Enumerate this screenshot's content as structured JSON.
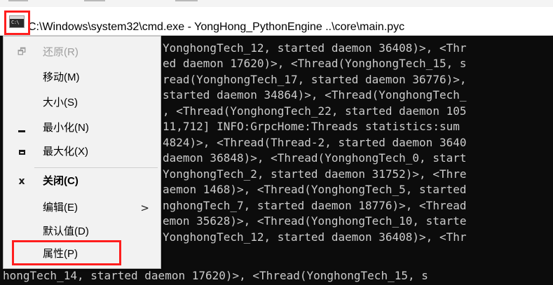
{
  "window": {
    "title": "C:\\Windows\\system32\\cmd.exe - YongHong_PythonEngine  ..\\core\\main.pyc",
    "icon_name": "cmd-icon",
    "icon_glyph": "C:\\"
  },
  "console": {
    "lines": [
      "YonghongTech_12, started daemon 36408)>, <Thr",
      "ed daemon 17620)>, <Thread(YonghongTech_15, s",
      "read(YonghongTech_17, started daemon 36776)>,",
      "started daemon 34864)>, <Thread(YonghongTech_",
      ", <Thread(YonghongTech_22, started daemon 105",
      "11,712] INFO:GrpcHome:Threads statistics:sum",
      "4824)>, <Thread(Thread-2, started daemon 3640",
      "daemon 36848)>, <Thread(YonghongTech_0, start",
      "YonghongTech_2, started daemon 31752)>, <Thre",
      "aemon 1468)>, <Thread(YonghongTech_5, started",
      "nghongTech_7, started daemon 18776)>, <Thread",
      "emon 35628)>, <Thread(YonghongTech_10, starte",
      "YonghongTech_12, started daemon 36408)>, <Thr",
      "hongTech_14, started daemon 17620)>, <Thread(YonghongTech_15, s"
    ]
  },
  "menu": {
    "items": [
      {
        "label": "还原(R)",
        "icon": "restore-icon",
        "glyph": "🗗",
        "enabled": false
      },
      {
        "label": "移动(M)",
        "icon": "",
        "glyph": "",
        "enabled": true
      },
      {
        "label": "大小(S)",
        "icon": "",
        "glyph": "",
        "enabled": true
      },
      {
        "label": "最小化(N)",
        "icon": "minimize-icon",
        "glyph": "",
        "enabled": true
      },
      {
        "label": "最大化(X)",
        "icon": "maximize-icon",
        "glyph": "",
        "enabled": true
      },
      {
        "label": "关闭(C)",
        "icon": "close-icon",
        "glyph": "x",
        "enabled": true,
        "bold": true
      },
      {
        "label": "编辑(E)",
        "icon": "",
        "glyph": "",
        "enabled": true,
        "submenu_arrow": ">"
      },
      {
        "label": "默认值(D)",
        "icon": "",
        "glyph": "",
        "enabled": true
      },
      {
        "label": "属性(P)",
        "icon": "",
        "glyph": "",
        "enabled": true,
        "highlighted": true
      }
    ]
  },
  "highlight_color": "#ff1e1e"
}
